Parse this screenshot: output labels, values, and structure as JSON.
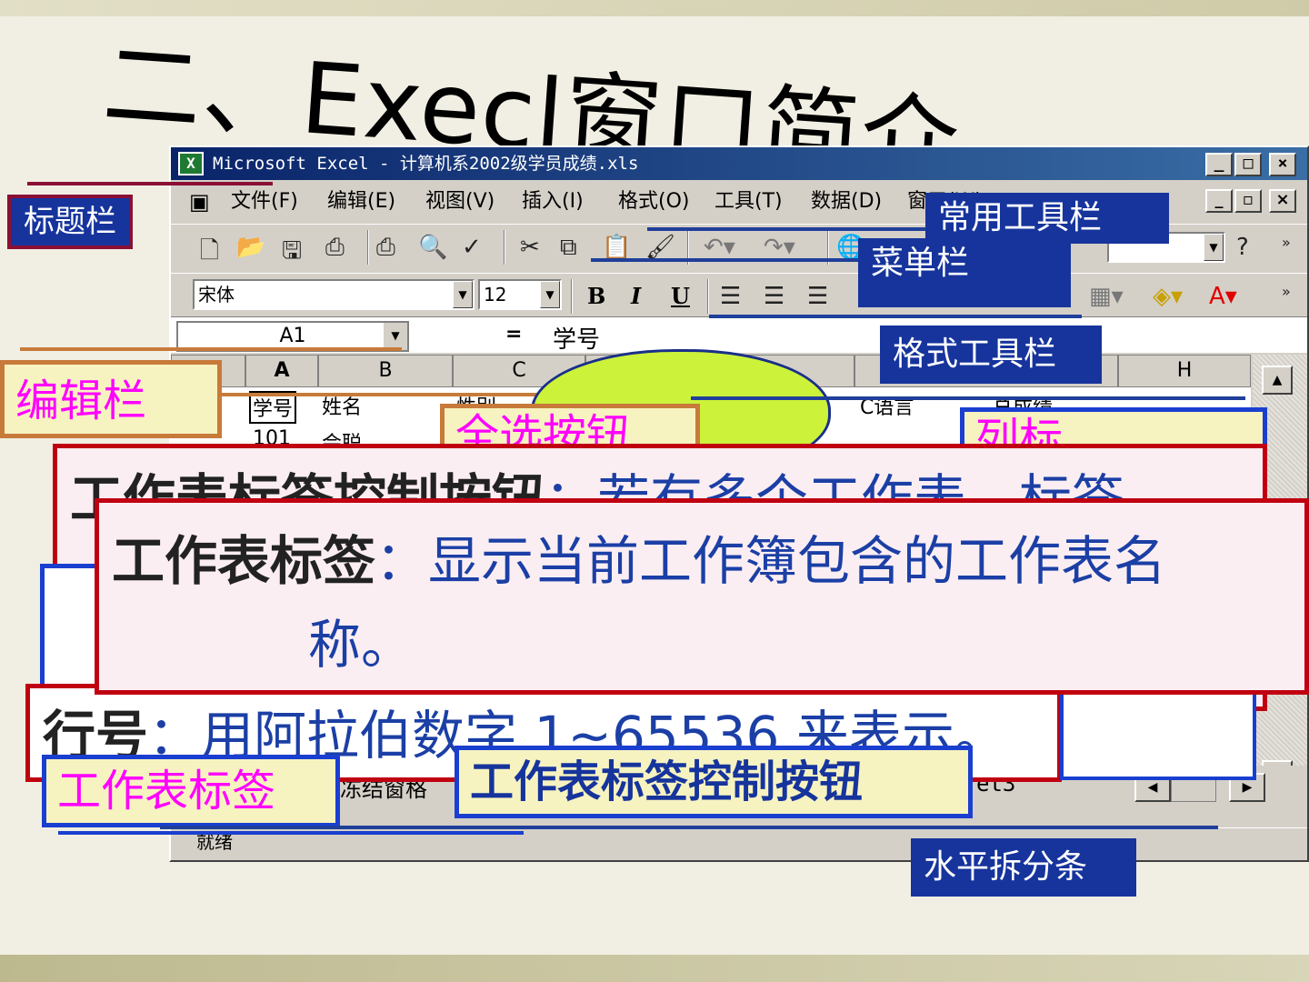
{
  "slide": {
    "title": "二、Execl窗口简介"
  },
  "excel": {
    "window_title": "Microsoft Excel - 计算机系2002级学员成绩.xls",
    "menus": [
      "文件(F)",
      "编辑(E)",
      "视图(V)",
      "插入(I)",
      "格式(O)",
      "工具(T)",
      "数据(D)",
      "窗口(W)"
    ],
    "font_name": "宋体",
    "font_size": "12",
    "name_box": "A1",
    "formula_equals": "=",
    "formula_value": "学号",
    "columns": [
      "A",
      "B",
      "C",
      "H"
    ],
    "cells": {
      "a1": "学号",
      "b1": "姓名",
      "c1": "性别",
      "f1": "C语言",
      "g1": "总成绩",
      "a2": "101",
      "b2": "会聪"
    },
    "sheet_tab_partial": "冻结窗格",
    "sheet_tab_3": "et3",
    "status": "就绪"
  },
  "callouts": {
    "title_bar": "标题栏",
    "standard_toolbar": "常用工具栏",
    "menu_bar": "菜单栏",
    "format_toolbar": "格式工具栏",
    "edit_bar": "编辑栏",
    "select_all": "全选按钮",
    "col_label": "列标",
    "sheet_tab": "工作表标签",
    "tab_control": "工作表标签控制按钮",
    "hsplit": "水平拆分条"
  },
  "cards": {
    "back_bold": "工作表标签控制按钮",
    "back_text": "：若有多个工作表，标签",
    "front_bold": "工作表标签",
    "front_text": "：显示当前工作簿包含的工作表名",
    "front_text2": "称。",
    "row_bold": "行号",
    "row_text": "：用阿拉伯数字 1~65536 来表示。"
  },
  "colors": {
    "callout_blue": "#16349c",
    "card_border": "#c00010",
    "magenta": "#ff00ff",
    "orange": "#c87a3a"
  }
}
